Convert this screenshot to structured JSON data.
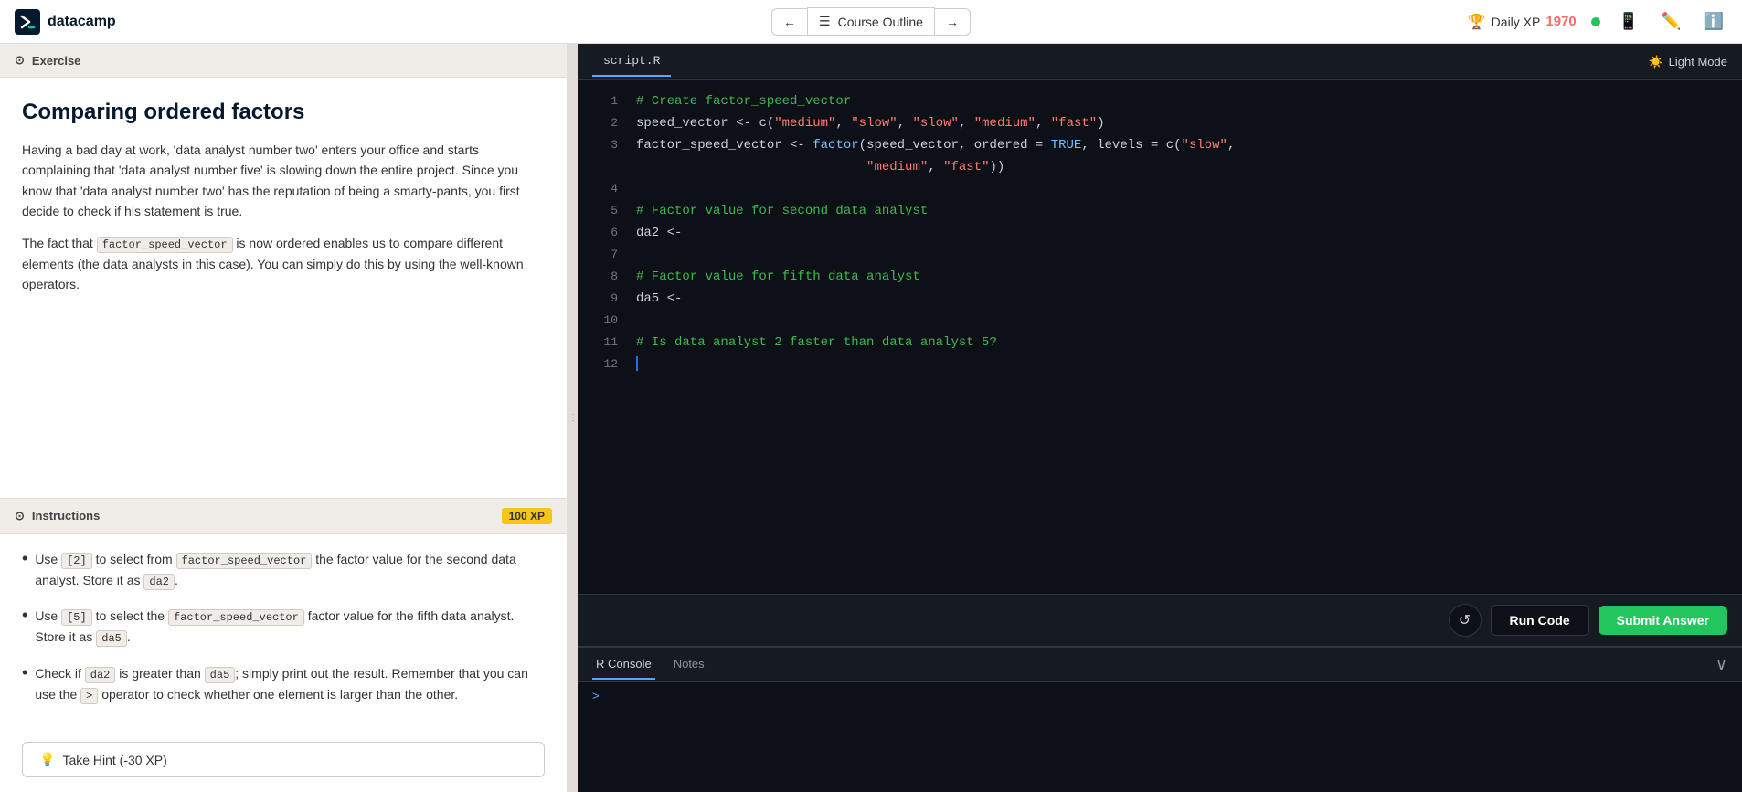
{
  "nav": {
    "logo_text": "datacamp",
    "prev_btn": "←",
    "course_outline": "Course Outline",
    "next_btn": "→",
    "daily_xp_label": "Daily XP",
    "daily_xp_count": "1970",
    "light_mode_label": "Light Mode"
  },
  "left": {
    "exercise_label": "Exercise",
    "title": "Comparing ordered factors",
    "desc1": "Having a bad day at work, 'data analyst number two' enters your office and starts complaining that 'data analyst number five' is slowing down the entire project. Since you know that 'data analyst number two' has the reputation of being a smarty-pants, you first decide to check if his statement is true.",
    "desc2_before": "The fact that ",
    "desc2_code": "factor_speed_vector",
    "desc2_after": " is now ordered enables us to compare different elements (the data analysts in this case). You can simply do this by using the well-known operators.",
    "instructions_label": "Instructions",
    "xp_badge": "100 XP",
    "inst1_pre": "Use ",
    "inst1_code1": "[2]",
    "inst1_mid": " to select from ",
    "inst1_code2": "factor_speed_vector",
    "inst1_post": " the factor value for the second data analyst. Store it as ",
    "inst1_code3": "da2",
    "inst1_end": ".",
    "inst2_pre": "Use ",
    "inst2_code1": "[5]",
    "inst2_mid": " to select the ",
    "inst2_code2": "factor_speed_vector",
    "inst2_post": " factor value for the fifth data analyst. Store it as ",
    "inst2_code3": "da5",
    "inst2_end": ".",
    "inst3_pre": "Check if ",
    "inst3_code1": "da2",
    "inst3_mid1": " is greater than ",
    "inst3_code2": "da5",
    "inst3_mid2": "; simply print out the result. Remember that you can use the ",
    "inst3_code3": ">",
    "inst3_post": " operator to check whether one element is larger than the other.",
    "hint_btn": "Take Hint (-30 XP)"
  },
  "editor": {
    "file_tab": "script.R",
    "light_mode": "Light Mode",
    "lines": [
      {
        "num": "1",
        "content": "# Create factor_speed_vector",
        "type": "comment"
      },
      {
        "num": "2",
        "content": "speed_vector <- c(\"medium\", \"slow\", \"slow\", \"medium\", \"fast\")",
        "type": "code"
      },
      {
        "num": "3",
        "content": "factor_speed_vector <- factor(speed_vector, ordered = TRUE, levels = c(\"slow\",",
        "type": "code"
      },
      {
        "num": "",
        "content": "                              \"medium\", \"fast\"))",
        "type": "code"
      },
      {
        "num": "4",
        "content": "",
        "type": "empty"
      },
      {
        "num": "5",
        "content": "# Factor value for second data analyst",
        "type": "comment"
      },
      {
        "num": "6",
        "content": "da2 <-",
        "type": "code"
      },
      {
        "num": "7",
        "content": "",
        "type": "empty"
      },
      {
        "num": "8",
        "content": "# Factor value for fifth data analyst",
        "type": "comment"
      },
      {
        "num": "9",
        "content": "da5 <-",
        "type": "code"
      },
      {
        "num": "10",
        "content": "",
        "type": "empty"
      },
      {
        "num": "11",
        "content": "# Is data analyst 2 faster than data analyst 5?",
        "type": "comment"
      },
      {
        "num": "12",
        "content": "",
        "type": "empty"
      }
    ],
    "reset_icon": "↺",
    "run_btn": "Run Code",
    "submit_btn": "Submit Answer"
  },
  "console": {
    "tab_r": "R Console",
    "tab_notes": "Notes",
    "prompt": ">",
    "collapse_icon": "∨"
  }
}
